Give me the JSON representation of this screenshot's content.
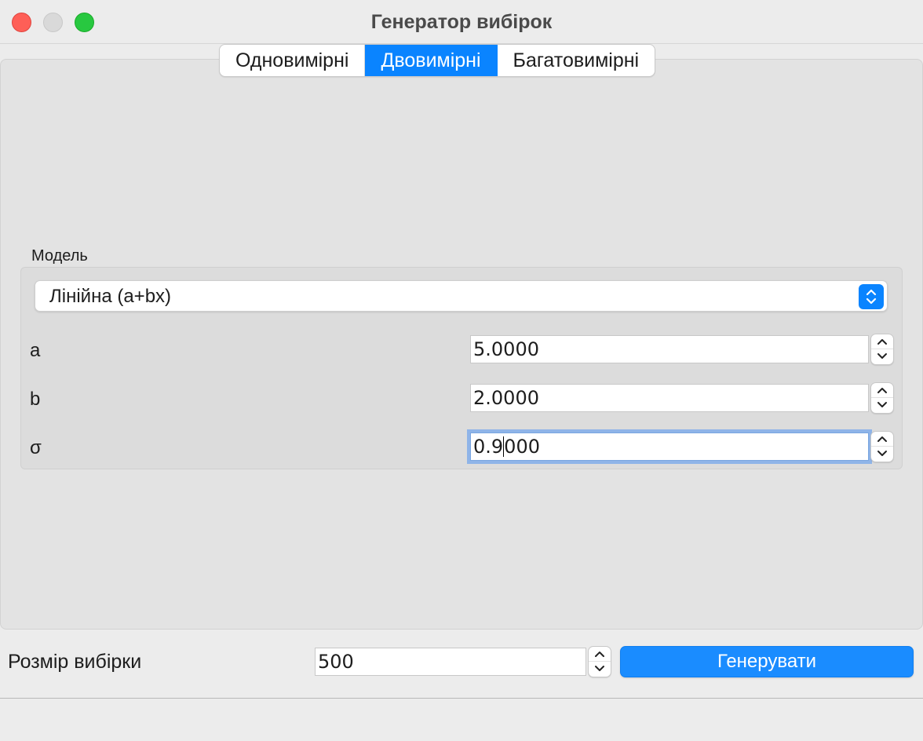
{
  "window": {
    "title": "Генератор вибірок"
  },
  "tabs": [
    {
      "label": "Одновимірні",
      "active": false
    },
    {
      "label": "Двовимірні",
      "active": true
    },
    {
      "label": "Багатовимірні",
      "active": false
    }
  ],
  "model": {
    "group_label": "Модель",
    "selected": "Лінійна (a+bx)"
  },
  "params": [
    {
      "label": "a",
      "value": "5.0000"
    },
    {
      "label": "b",
      "value": "2.0000"
    },
    {
      "label": "σ",
      "value_before_caret": "0.9",
      "value_after_caret": "000",
      "focused": true
    }
  ],
  "bottom": {
    "size_label": "Розмір вибірки",
    "size_value": "500",
    "generate_label": "Генерувати"
  },
  "colors": {
    "accent": "#0a84ff",
    "close": "#fe5f57",
    "maximize": "#28c840"
  }
}
